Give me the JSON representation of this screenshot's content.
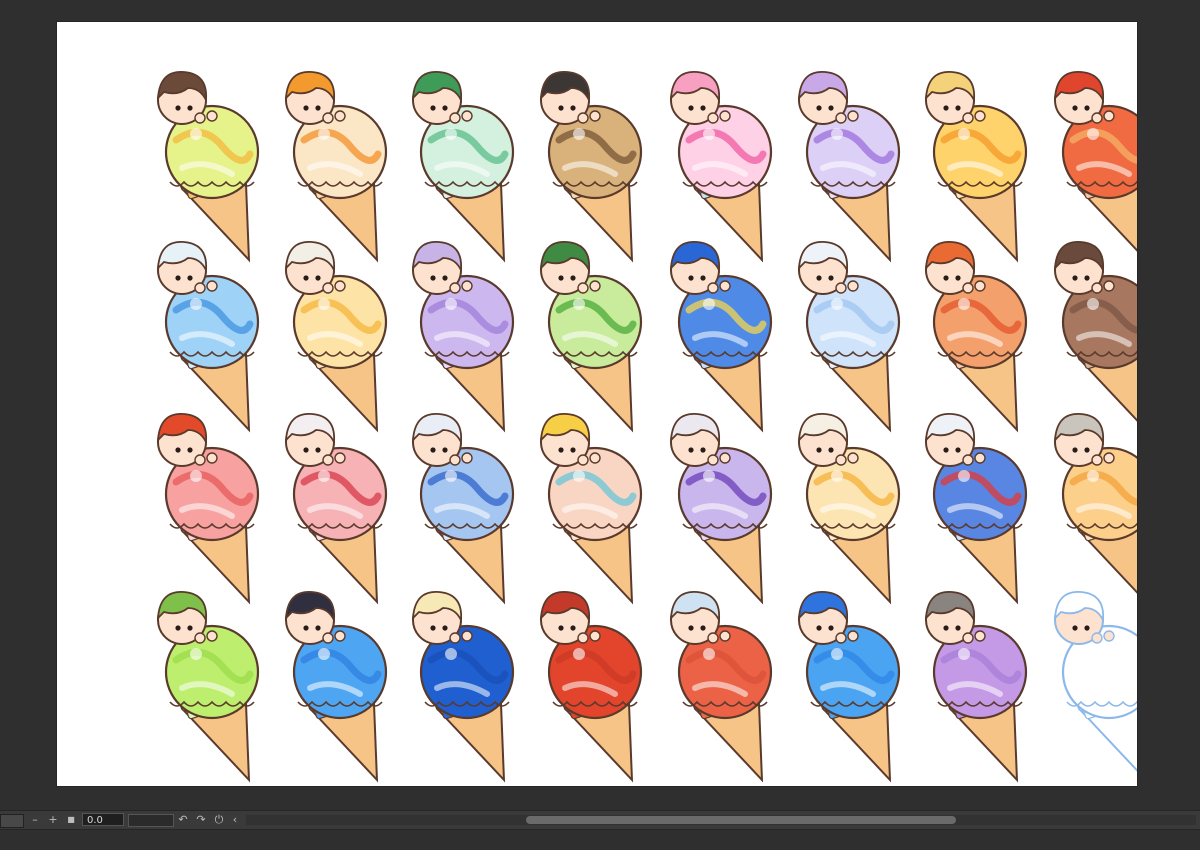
{
  "canvas": {
    "background": "#ffffff",
    "rows": [
      [
        {
          "hair": "#6b4a3a",
          "scoop": "#e6f28a",
          "accent": "#f4b93b",
          "cone_bands": [
            "#f5e58a",
            "#f7c16a"
          ]
        },
        {
          "hair": "#f39a2e",
          "scoop": "#fbe7c6",
          "accent": "#f4902a",
          "cone_bands": [
            "#f6b14d",
            "#fdd9a3"
          ]
        },
        {
          "hair": "#3f9c58",
          "scoop": "#d4f0df",
          "accent": "#5bbf8a",
          "cone_bands": [
            "#9fdcb6",
            "#dff4e8"
          ]
        },
        {
          "hair": "#3c3634",
          "scoop": "#d8b27a",
          "accent": "#7a5637",
          "cone_bands": [
            "#c89a5c",
            "#f1ddb0"
          ]
        },
        {
          "hair": "#f7a0c2",
          "scoop": "#ffd1e6",
          "accent": "#f05aa0",
          "cone_bands": [
            "#f7a9cf",
            "#bde4f6"
          ]
        },
        {
          "hair": "#c8a8e6",
          "scoop": "#dcd0f6",
          "accent": "#9c6fdc",
          "cone_bands": [
            "#c3a8ef",
            "#e9e0fb"
          ]
        },
        {
          "hair": "#f4d27a",
          "scoop": "#ffd36b",
          "accent": "#f59a27",
          "cone_bands": [
            "#f9c14d",
            "#fde8b0"
          ]
        },
        {
          "hair": "#e0462e",
          "scoop": "#f06a42",
          "accent": "#f7b26a",
          "cone_bands": [
            "#f48a5a",
            "#f9c59c"
          ]
        }
      ],
      [
        {
          "hair": "#e6f1f8",
          "scoop": "#9fd2f7",
          "accent": "#3f93e0",
          "cone_bands": [
            "#8cc6f2",
            "#d8eefb"
          ]
        },
        {
          "hair": "#f2efe6",
          "scoop": "#fde3a6",
          "accent": "#f4b63a",
          "cone_bands": [
            "#f6c76b",
            "#fbe7b8"
          ]
        },
        {
          "hair": "#c8b3e6",
          "scoop": "#cdb7ef",
          "accent": "#9f7fdb",
          "cone_bands": [
            "#bda3ec",
            "#e6dcfb"
          ]
        },
        {
          "hair": "#3f8b44",
          "scoop": "#c8ec9c",
          "accent": "#4caa3a",
          "cone_bands": [
            "#a6dc7a",
            "#e2f5cf"
          ]
        },
        {
          "hair": "#2a67d6",
          "scoop": "#4f8be6",
          "accent": "#f3d64f",
          "cone_bands": [
            "#6aa4ee",
            "#c9e1fb"
          ]
        },
        {
          "hair": "#eef3f9",
          "scoop": "#cfe3fb",
          "accent": "#9fc6f2",
          "cone_bands": [
            "#b6d6f6",
            "#e6f1fd"
          ]
        },
        {
          "hair": "#ea6a34",
          "scoop": "#f3a06c",
          "accent": "#e4562c",
          "cone_bands": [
            "#f1925c",
            "#f9ccab"
          ]
        },
        {
          "hair": "#6a4a3c",
          "scoop": "#a77760",
          "accent": "#7c5544",
          "cone_bands": [
            "#a6715a",
            "#d7b39c"
          ]
        }
      ],
      [
        {
          "hair": "#e24a2a",
          "scoop": "#f7a2a0",
          "accent": "#e85a5a",
          "cone_bands": [
            "#f5a39a",
            "#fcd6cf"
          ]
        },
        {
          "hair": "#f3eef0",
          "scoop": "#f7b2b6",
          "accent": "#d83a48",
          "cone_bands": [
            "#f3a3a8",
            "#fde0e2"
          ]
        },
        {
          "hair": "#e9eef6",
          "scoop": "#a6c6f2",
          "accent": "#2f63c9",
          "cone_bands": [
            "#8fb4ec",
            "#dbe7fa"
          ]
        },
        {
          "hair": "#f7cf47",
          "scoop": "#f9d6c3",
          "accent": "#6ac6d8",
          "cone_bands": [
            "#f6c7a2",
            "#fde6d3"
          ]
        },
        {
          "hair": "#ebe8f0",
          "scoop": "#c9b6ec",
          "accent": "#6a3fb8",
          "cone_bands": [
            "#b89ce8",
            "#e6dcf9"
          ]
        },
        {
          "hair": "#f6f0e4",
          "scoop": "#fde4b3",
          "accent": "#f4b23a",
          "cone_bands": [
            "#f7cf86",
            "#fdedcc"
          ]
        },
        {
          "hair": "#eef1f6",
          "scoop": "#5a86e3",
          "accent": "#e03a3a",
          "cone_bands": [
            "#7fa0ea",
            "#d6e0fa"
          ]
        },
        {
          "hair": "#c9c4bc",
          "scoop": "#fccf8a",
          "accent": "#f4a13a",
          "cone_bands": [
            "#f7c07c",
            "#fde3c0"
          ]
        }
      ],
      [
        {
          "hair": "#7fc04a",
          "scoop": "#bdee6e",
          "accent": "#9bdc4a",
          "cone_bands": [
            "#b4e66a",
            "#e0f6c0"
          ]
        },
        {
          "hair": "#2f2f3f",
          "scoop": "#4ea6f2",
          "accent": "#2f7fe0",
          "cone_bands": [
            "#4ea0ee",
            "#4ea0ee"
          ]
        },
        {
          "hair": "#f6e9b6",
          "scoop": "#1f5fd0",
          "accent": "#1a4fb8",
          "cone_bands": [
            "#2a66d4",
            "#2a66d4"
          ]
        },
        {
          "hair": "#c43a2a",
          "scoop": "#e2442c",
          "accent": "#c93a24",
          "cone_bands": [
            "#e0442c",
            "#e0442c"
          ]
        },
        {
          "hair": "#cfe2f2",
          "scoop": "#eb6246",
          "accent": "#d9523a",
          "cone_bands": [
            "#ea6a4c",
            "#ea6a4c"
          ]
        },
        {
          "hair": "#2f73de",
          "scoop": "#4aa4f1",
          "accent": "#2f86e6",
          "cone_bands": [
            "#4aa0ef",
            "#4aa0ef"
          ]
        },
        {
          "hair": "#8a8480",
          "scoop": "#c49ae6",
          "accent": "#a77cd8",
          "cone_bands": [
            "#b88fe2",
            "#b88fe2"
          ]
        },
        {
          "hair": "#ffffff",
          "scoop": "#ffffff",
          "accent": "#8cb8ea",
          "cone_bands": [
            "#ffffff",
            "#ffffff"
          ],
          "outline": true
        }
      ]
    ]
  },
  "statusbar": {
    "zoom_minus": "–",
    "zoom_plus": "+",
    "zoom_stop": "■",
    "zoom_value": "0.0",
    "undo_icon": "↶",
    "redo_icon": "↷",
    "reset_icon": "⏻",
    "collapse_icon": "‹"
  }
}
